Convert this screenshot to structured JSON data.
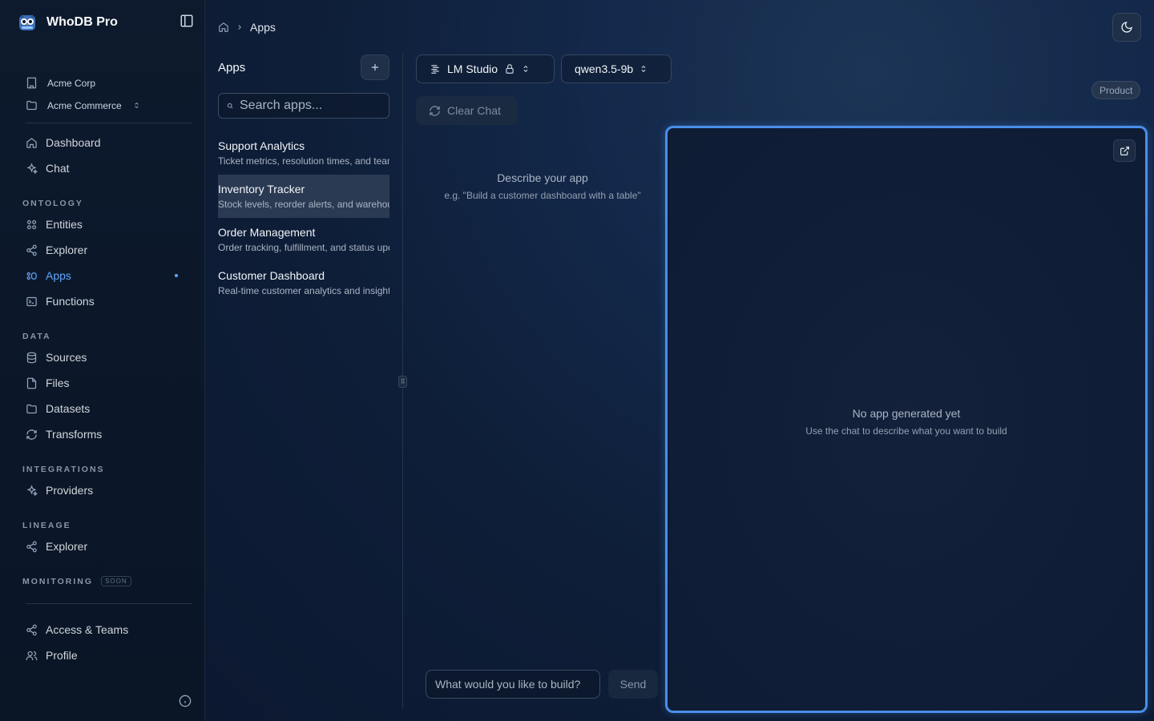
{
  "brand": {
    "name": "WhoDB Pro"
  },
  "org": {
    "company": "Acme Corp",
    "workspace": "Acme Commerce"
  },
  "nav": {
    "dashboard": "Dashboard",
    "chat": "Chat",
    "ontology_label": "ONTOLOGY",
    "entities": "Entities",
    "explorer": "Explorer",
    "apps": "Apps",
    "functions": "Functions",
    "data_label": "DATA",
    "sources": "Sources",
    "files": "Files",
    "datasets": "Datasets",
    "transforms": "Transforms",
    "integrations_label": "INTEGRATIONS",
    "providers": "Providers",
    "lineage_label": "LINEAGE",
    "lineage_explorer": "Explorer",
    "monitoring_label": "MONITORING",
    "monitoring_badge": "SOON",
    "access_teams": "Access & Teams",
    "profile": "Profile",
    "active_item": "Apps"
  },
  "breadcrumb": {
    "current": "Apps"
  },
  "apps_panel": {
    "title": "Apps",
    "search_placeholder": "Search apps...",
    "items": [
      {
        "name": "Support Analytics",
        "description": "Ticket metrics, resolution times, and team performance"
      },
      {
        "name": "Inventory Tracker",
        "description": "Stock levels, reorder alerts, and warehouse overview"
      },
      {
        "name": "Order Management",
        "description": "Order tracking, fulfillment, and status updates"
      },
      {
        "name": "Customer Dashboard",
        "description": "Real-time customer analytics and insights"
      }
    ],
    "selected": "Inventory Tracker"
  },
  "chat": {
    "provider": "LM Studio",
    "model": "qwen3.5-9b",
    "clear_label": "Clear Chat",
    "empty_title": "Describe your app",
    "empty_hint": "e.g. \"Build a customer dashboard with a table\"",
    "input_placeholder": "What would you like to build?",
    "send_label": "Send"
  },
  "preview": {
    "badge": "Product",
    "empty_title": "No app generated yet",
    "empty_hint": "Use the chat to describe what you want to build"
  },
  "colors": {
    "accent": "#60a5fa",
    "preview_border": "#4a8eea"
  }
}
